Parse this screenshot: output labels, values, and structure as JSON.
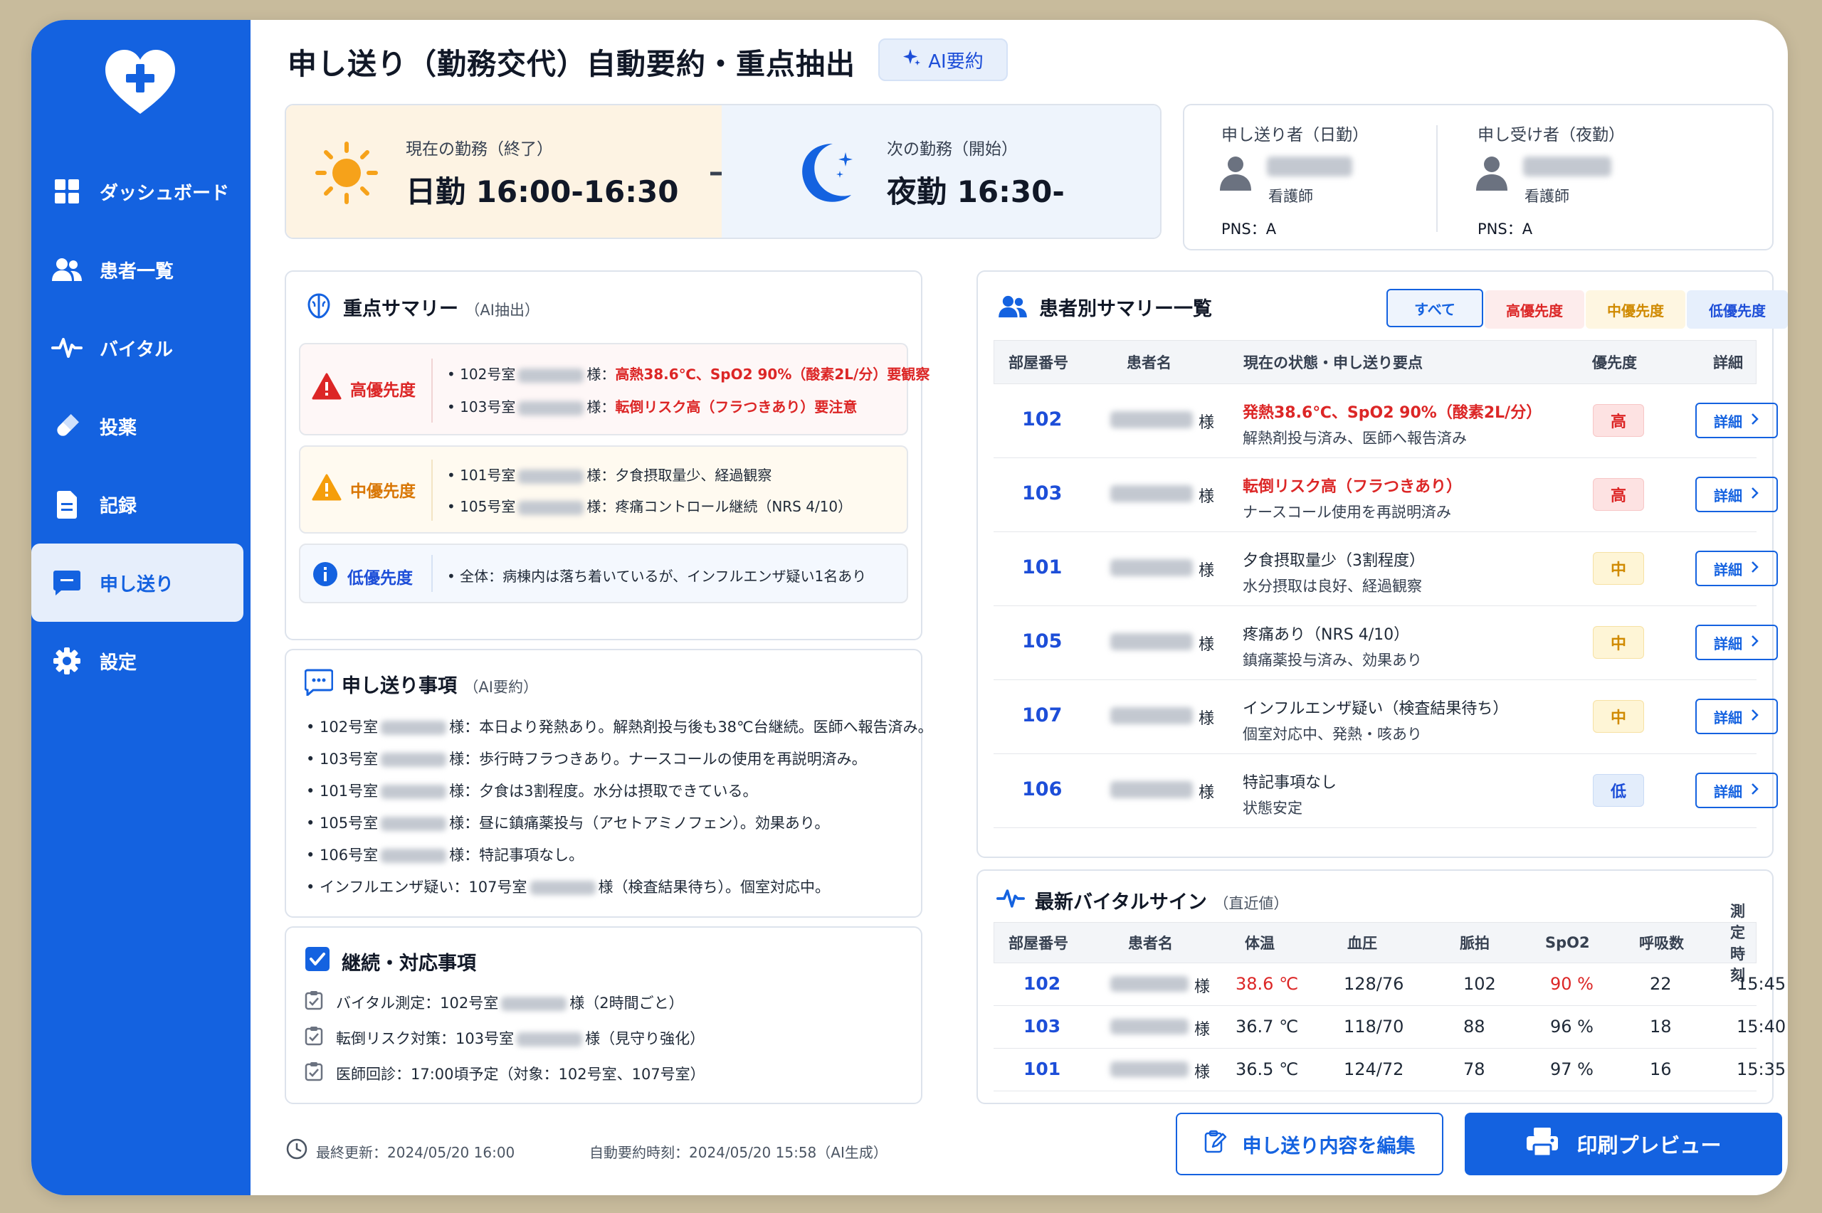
{
  "sidebar": {
    "items": [
      {
        "label": "ダッシュボード",
        "icon": "grid-icon"
      },
      {
        "label": "患者一覧",
        "icon": "users-icon"
      },
      {
        "label": "バイタル",
        "icon": "pulse-icon"
      },
      {
        "label": "投薬",
        "icon": "pill-icon"
      },
      {
        "label": "記録",
        "icon": "document-icon"
      },
      {
        "label": "申し送り",
        "icon": "chat-icon",
        "active": true
      },
      {
        "label": "設定",
        "icon": "gear-icon"
      }
    ]
  },
  "header": {
    "title": "申し送り（勤務交代）自動要約・重点抽出",
    "ai_button": "AI要約"
  },
  "shift": {
    "current_label": "現在の勤務（終了）",
    "current_value": "日勤 16:00-16:30",
    "next_label": "次の勤務（開始）",
    "next_value": "夜勤 16:30-"
  },
  "handover": {
    "giver_label": "申し送り者（日勤）",
    "giver_role": "看護師",
    "giver_pns": "PNS：A",
    "receiver_label": "申し受け者（夜勤）",
    "receiver_role": "看護師",
    "receiver_pns": "PNS：A"
  },
  "summary": {
    "title": "重点サマリー",
    "subtitle": "（AI抽出）",
    "high": {
      "label": "高優先度",
      "items": [
        {
          "room": "• 102号室",
          "suffix": "様：",
          "text": "高熱38.6℃、SpO2 90%（酸素2L/分）要観察"
        },
        {
          "room": "• 103号室",
          "suffix": "様：",
          "text": "転倒リスク高（フラつきあり）要注意"
        }
      ]
    },
    "mid": {
      "label": "中優先度",
      "items": [
        {
          "room": "• 101号室",
          "suffix": "様：",
          "text": "夕食摂取量少、経過観察"
        },
        {
          "room": "• 105号室",
          "suffix": "様：",
          "text": "疼痛コントロール継続（NRS 4/10）"
        }
      ]
    },
    "low": {
      "label": "低優先度",
      "text": "• 全体：病棟内は落ち着いているが、インフルエンザ疑い1名あり"
    }
  },
  "notes": {
    "title": "申し送り事項",
    "subtitle": "（AI要約）",
    "items": [
      {
        "pre": "• 102号室",
        "post": "様：本日より発熱あり。解熱剤投与後も38℃台継続。医師へ報告済み。"
      },
      {
        "pre": "• 103号室",
        "post": "様：歩行時フラつきあり。ナースコールの使用を再説明済み。"
      },
      {
        "pre": "• 101号室",
        "post": "様：夕食は3割程度。水分は摂取できている。"
      },
      {
        "pre": "• 105号室",
        "post": "様：昼に鎮痛薬投与（アセトアミノフェン）。効果あり。"
      },
      {
        "pre": "• 106号室",
        "post": "様：特記事項なし。"
      },
      {
        "pre": "• インフルエンザ疑い：107号室",
        "post": "様（検査結果待ち）。個室対応中。"
      }
    ]
  },
  "tasks": {
    "title": "継続・対応事項",
    "items": [
      {
        "pre": "バイタル測定：102号室",
        "post": "様（2時間ごと）"
      },
      {
        "pre": "転倒リスク対策：103号室",
        "post": "様（見守り強化）"
      },
      {
        "pre": "医師回診：17:00頃予定（対象：102号室、107号室）",
        "post": ""
      }
    ]
  },
  "patients": {
    "title": "患者別サマリー一覧",
    "filters": [
      "すべて",
      "高優先度",
      "中優先度",
      "低優先度"
    ],
    "columns": [
      "部屋番号",
      "患者名",
      "現在の状態・申し送り要点",
      "優先度",
      "詳細"
    ],
    "rows": [
      {
        "room": "102",
        "suffix": "様",
        "line1": "発熱38.6℃、SpO2 90%（酸素2L/分）",
        "line2": "解熱剤投与済み、医師へ報告済み",
        "priority": "高",
        "level": "high",
        "detail": "詳細"
      },
      {
        "room": "103",
        "suffix": "様",
        "line1": "転倒リスク高（フラつきあり）",
        "line2": "ナースコール使用を再説明済み",
        "priority": "高",
        "level": "high",
        "detail": "詳細"
      },
      {
        "room": "101",
        "suffix": "様",
        "line1": "夕食摂取量少（3割程度）",
        "line2": "水分摂取は良好、経過観察",
        "priority": "中",
        "level": "mid",
        "detail": "詳細"
      },
      {
        "room": "105",
        "suffix": "様",
        "line1": "疼痛あり（NRS 4/10）",
        "line2": "鎮痛薬投与済み、効果あり",
        "priority": "中",
        "level": "mid",
        "detail": "詳細"
      },
      {
        "room": "107",
        "suffix": "様",
        "line1": "インフルエンザ疑い（検査結果待ち）",
        "line2": "個室対応中、発熱・咳あり",
        "priority": "中",
        "level": "mid",
        "detail": "詳細"
      },
      {
        "room": "106",
        "suffix": "様",
        "line1": "特記事項なし",
        "line2": "状態安定",
        "priority": "低",
        "level": "low",
        "detail": "詳細"
      }
    ]
  },
  "vitals": {
    "title": "最新バイタルサイン",
    "subtitle": "（直近値）",
    "columns": [
      "部屋番号",
      "患者名",
      "体温",
      "血圧",
      "脈拍",
      "SpO2",
      "呼吸数",
      "測定時刻"
    ],
    "rows": [
      {
        "room": "102",
        "suffix": "様",
        "temp": "38.6 ℃",
        "bp": "128/76",
        "pulse": "102",
        "spo2": "90 %",
        "resp": "22",
        "time": "15:45",
        "alert": true
      },
      {
        "room": "103",
        "suffix": "様",
        "temp": "36.7 ℃",
        "bp": "118/70",
        "pulse": "88",
        "spo2": "96 %",
        "resp": "18",
        "time": "15:40",
        "alert": false
      },
      {
        "room": "101",
        "suffix": "様",
        "temp": "36.5 ℃",
        "bp": "124/72",
        "pulse": "78",
        "spo2": "97 %",
        "resp": "16",
        "time": "15:35",
        "alert": false
      }
    ]
  },
  "footer": {
    "last_updated": "最終更新：2024/05/20 16:00",
    "auto_summary": "自動要約時刻：2024/05/20 15:58（AI生成）",
    "edit_button": "申し送り内容を編集",
    "print_button": "印刷プレビュー"
  },
  "colors": {
    "primary": "#1462e0",
    "high": "#dc2626",
    "mid": "#d97706",
    "low": "#1d4ed8"
  }
}
